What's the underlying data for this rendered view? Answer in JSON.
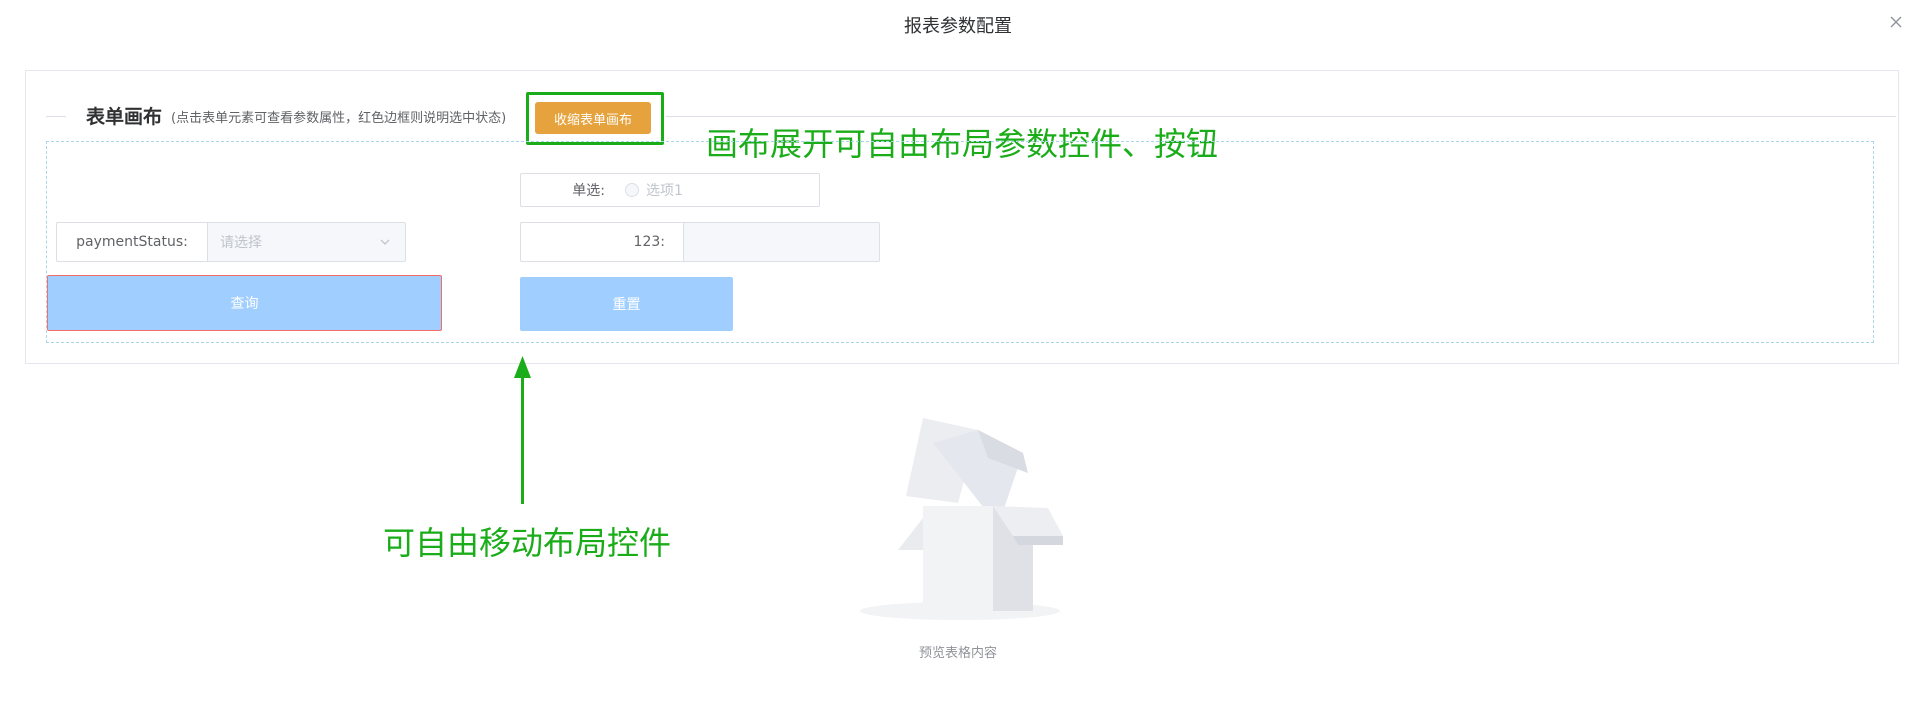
{
  "dialog": {
    "title": "报表参数配置",
    "close_icon": "close-icon"
  },
  "canvas": {
    "title": "表单画布",
    "hint": "(点击表单元素可查看参数属性，红色边框则说明选中状态)",
    "collapse_button_label": "收缩表单画布"
  },
  "form": {
    "radio": {
      "label": "单选:",
      "option": "选项1"
    },
    "select": {
      "label": "paymentStatus:",
      "placeholder": "请选择",
      "icon": "chevron-down-icon"
    },
    "input": {
      "label": "123:",
      "value": ""
    },
    "query_button_label": "查询",
    "reset_button_label": "重置"
  },
  "annotations": {
    "top": "画布展开可自由布局参数控件、按钮",
    "bottom": "可自由移动布局控件",
    "color": "#1aad19"
  },
  "empty_state": {
    "text": "预览表格内容",
    "icon": "empty-box-icon"
  },
  "colors": {
    "collapse_button": "#e6a23c",
    "primary_button_disabled": "#a0cfff",
    "selected_border": "#f56c6c",
    "canvas_dashed_border": "#a9d6e8"
  }
}
